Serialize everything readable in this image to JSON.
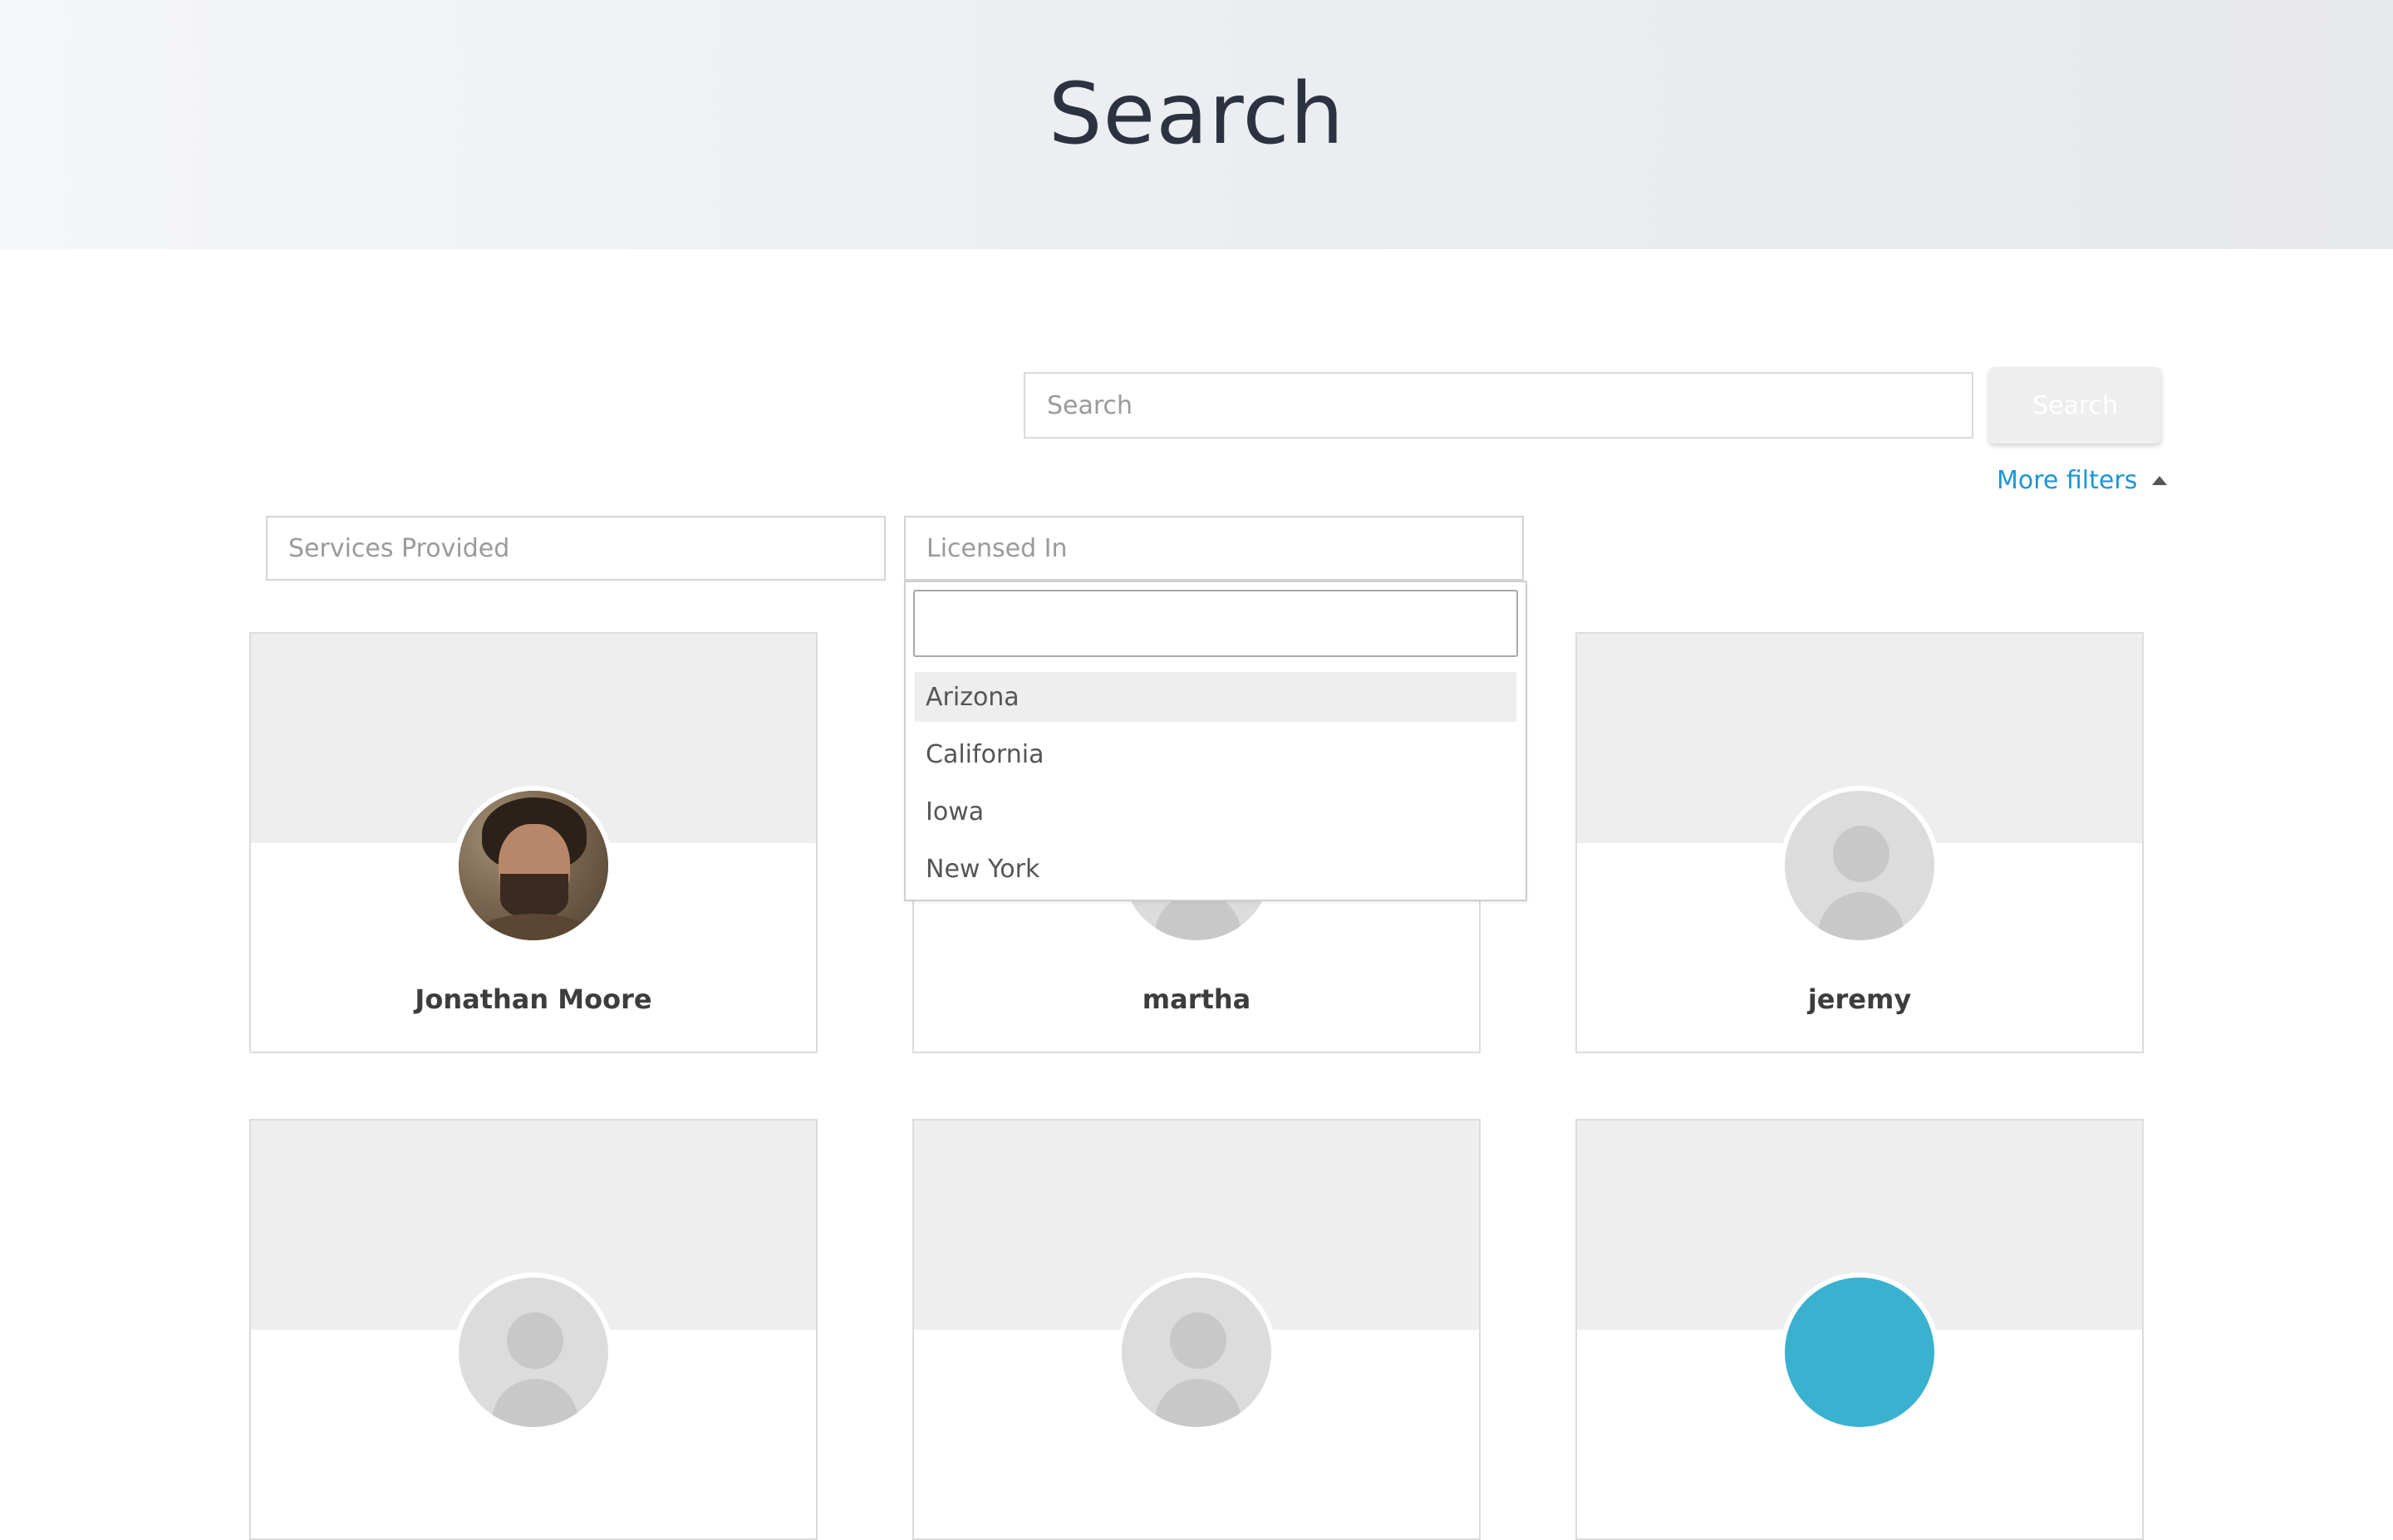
{
  "header": {
    "title": "Search"
  },
  "search": {
    "placeholder": "Search",
    "button_label": "Search"
  },
  "filters": {
    "more_filters_label": "More filters",
    "services_placeholder": "Services Provided",
    "licensed_placeholder": "Licensed In"
  },
  "licensed_dropdown": {
    "search_value": "",
    "options": [
      "Arizona",
      "California",
      "Iowa",
      "New York"
    ],
    "highlighted_option": "Arizona"
  },
  "profiles": [
    {
      "name": "Jonathan Moore",
      "avatar": "photo"
    },
    {
      "name": "martha",
      "avatar": "default-user-icon"
    },
    {
      "name": "jeremy",
      "avatar": "default-user-icon"
    },
    {
      "name": "",
      "avatar": "default-user-icon"
    },
    {
      "name": "",
      "avatar": "default-user-icon"
    },
    {
      "name": "",
      "avatar": "teal"
    }
  ],
  "colors": {
    "link": "#1d96d5",
    "title": "#2c3240",
    "card_cover": "#eeeeee",
    "teal_avatar": "#3ab2cf"
  }
}
